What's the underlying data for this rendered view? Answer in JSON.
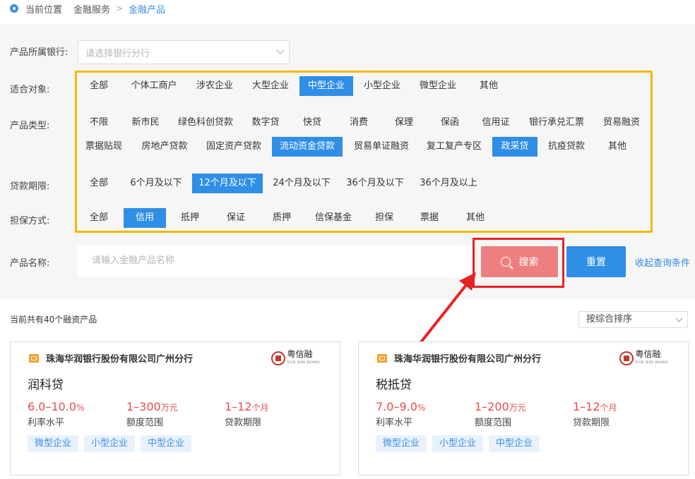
{
  "breadcrumb": {
    "label": "当前位置",
    "items": [
      "金融服务"
    ],
    "current": "金融产品"
  },
  "filters": {
    "bank_label": "产品所属银行:",
    "bank_placeholder": "请选择银行分行",
    "target_label": "适合对象:",
    "target_options": [
      "全部",
      "个体工商户",
      "涉农企业",
      "大型企业",
      "中型企业",
      "小型企业",
      "微型企业",
      "其他"
    ],
    "target_selected": "中型企业",
    "type_label": "产品类型:",
    "type_options": [
      "不限",
      "新市民",
      "绿色科创贷款",
      "数字贷",
      "快贷",
      "消费",
      "保理",
      "保函",
      "信用证",
      "银行承兑汇票",
      "贸易融资",
      "票据贴现",
      "房地产贷款",
      "固定资产贷款",
      "流动资金贷款",
      "贸易单证融资",
      "复工复产专区",
      "政采贷",
      "抗疫贷款",
      "其他"
    ],
    "type_selected": [
      "流动资金贷款",
      "政采贷"
    ],
    "term_label": "贷款期限:",
    "term_options": [
      "全部",
      "6个月及以下",
      "12个月及以下",
      "24个月及以下",
      "36个月及以下",
      "36个月及以上"
    ],
    "term_selected": "12个月及以下",
    "guarantee_label": "担保方式:",
    "guarantee_options": [
      "全部",
      "信用",
      "抵押",
      "保证",
      "质押",
      "信保基金",
      "担保",
      "票据",
      "其他"
    ],
    "guarantee_selected": "信用",
    "name_label": "产品名称:",
    "name_placeholder": "请输入金融产品名称",
    "search_label": "搜索",
    "reset_label": "重置",
    "collapse_label": "收起查询条件"
  },
  "results": {
    "count_text": "当前共有40个融资产品",
    "sort_label": "按综合排序"
  },
  "brand": {
    "name": "粤信融",
    "pinyin": "YUE XIN RONG"
  },
  "cards": [
    {
      "bank": "珠海华润银行股份有限公司广州分行",
      "title": "润科贷",
      "rate_value": "6.0–10.0",
      "rate_unit": "%",
      "rate_label": "利率水平",
      "amount_value": "1–300",
      "amount_unit": "万元",
      "amount_label": "额度范围",
      "term_value": "1–12",
      "term_unit": "个月",
      "term_label": "贷款期限",
      "tags": [
        "微型企业",
        "小型企业",
        "中型企业"
      ]
    },
    {
      "bank": "珠海华润银行股份有限公司广州分行",
      "title": "税抵贷",
      "rate_value": "7.0–9.0",
      "rate_unit": "%",
      "rate_label": "利率水平",
      "amount_value": "1–200",
      "amount_unit": "万元",
      "amount_label": "额度范围",
      "term_value": "1–12",
      "term_unit": "个月",
      "term_label": "贷款期限",
      "tags": [
        "微型企业",
        "小型企业",
        "中型企业"
      ]
    }
  ],
  "colors": {
    "accent": "#2f8ee6",
    "highlight_box": "#f5b800",
    "annotation_red": "#e82323",
    "search_button": "#ee7f80",
    "value_red": "#e84c4c"
  }
}
